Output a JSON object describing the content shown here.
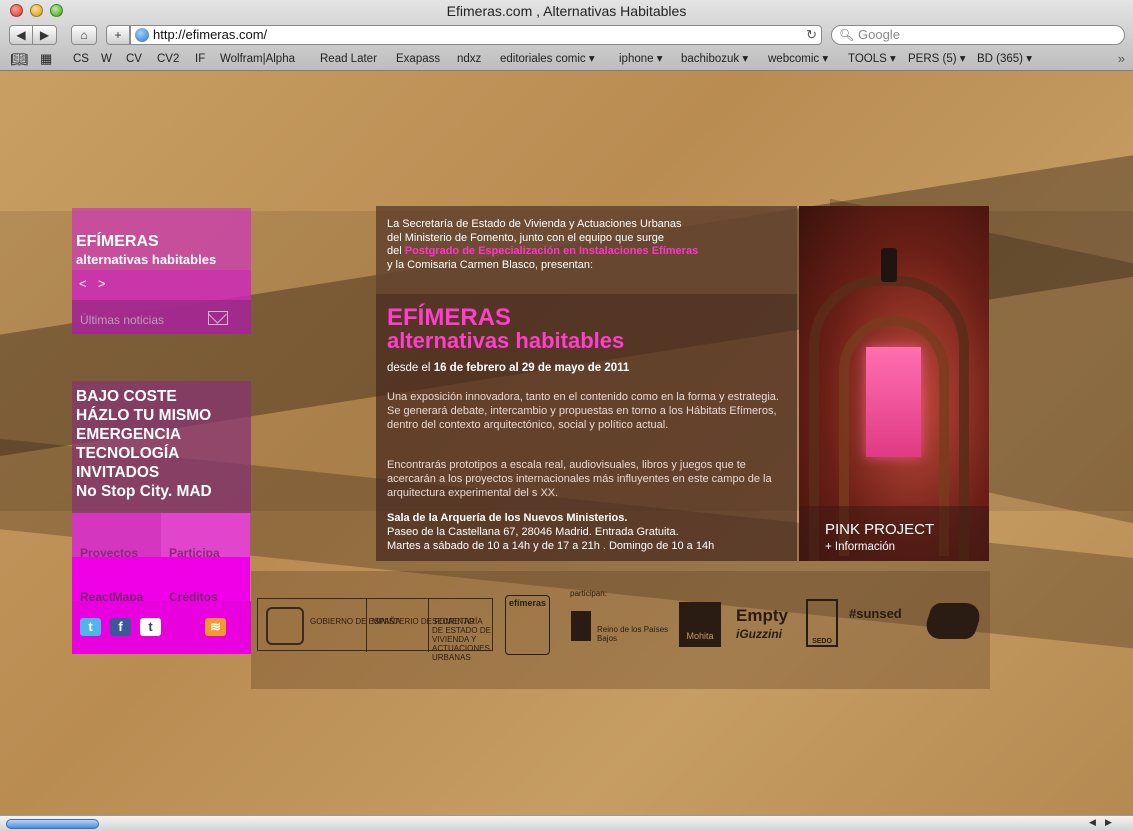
{
  "window": {
    "title": "Efimeras.com , Alternativas Habitables"
  },
  "toolbar": {
    "back": "◀",
    "forward": "▶",
    "home": "⌂",
    "add": "+",
    "url": "http://efimeras.com/",
    "reload": "↻",
    "search_placeholder": "Google",
    "search_icon": "🔍︎"
  },
  "bookmarks": [
    {
      "label": "CS"
    },
    {
      "label": "W"
    },
    {
      "label": "CV"
    },
    {
      "label": "CV2"
    },
    {
      "label": "IF"
    },
    {
      "label": "Wolfram|Alpha"
    },
    {
      "label": "Read Later"
    },
    {
      "label": "Exapass"
    },
    {
      "label": "ndxz"
    },
    {
      "label": "editoriales comic ▾"
    },
    {
      "label": "iphone ▾"
    },
    {
      "label": "bachibozuk ▾"
    },
    {
      "label": "webcomic ▾"
    },
    {
      "label": "TOOLS ▾"
    },
    {
      "label": "PERS (5) ▾"
    },
    {
      "label": "BD (365) ▾"
    }
  ],
  "sidebar": {
    "title": "EFÍMERAS",
    "subtitle": "alternativas habitables",
    "prev": "<",
    "next": ">",
    "news": "Últimas noticias",
    "topics": [
      "BAJO COSTE",
      "HÁZLO TU MISMO",
      "EMERGENCIA",
      "TECNOLOGÍA",
      "INVITADOS",
      "No Stop City. MAD"
    ],
    "menu": {
      "proyectos": "Proyectos",
      "participa": "Participa",
      "reactmapa": "ReactMapa",
      "creditos": "Créditos"
    },
    "social": {
      "twitter": "t",
      "facebook": "f",
      "tumblr": "t",
      "rss": "≋"
    }
  },
  "center": {
    "intro_1": "La Secretaría de Estado de Vivienda y Actuaciones Urbanas",
    "intro_2": "del Ministerio de Fomento, junto con el equipo que surge",
    "intro_3a": "del ",
    "intro_3b": "Postgrado de Especialización en Instalaciones Efímeras",
    "intro_4": "y la Comisaria Carmen Blasco, presentan:",
    "title": "EFÍMERAS",
    "subtitle": "alternativas habitables",
    "dates_a": "desde el ",
    "dates_b": "16 de febrero al 29 de mayo de 2011",
    "desc1": "Una exposición innovadora, tanto en el contenido como en la forma y estrategia. Se generará debate, intercambio y propuestas en torno a los Hábitats Efímeros, dentro del contexto arquitectónico, social y político actual.",
    "desc2": "Encontrarás prototipos a escala real, audiovisuales, libros y juegos que te acercarán a los proyectos internacionales más influyentes en este campo de la arquitectura experimental del s XX.",
    "venue_name": "Sala de la Arquería de los Nuevos Ministerios.",
    "venue_address": "Paseo de la Castellana 67, 28046 Madrid. Entrada Gratuita.",
    "venue_hours": "Martes a sábado de 10 a 14h y de 17 a 21h . Domingo de 10 a 14h"
  },
  "photo": {
    "title": "PINK PROJECT",
    "info": "+ Información"
  },
  "logos": {
    "gobierno": "GOBIERNO DE ESPAÑA",
    "ministerio": "MINISTERIO DE FOMENTO",
    "secretaria": "SECRETARÍA DE ESTADO DE VIVIENDA Y ACTUACIONES URBANAS",
    "efimeras": "efímeras",
    "participan": "participan:",
    "paises": "Reino de los Países Bajos",
    "mohita": "Mohita",
    "empty": "Empty",
    "iguzzini": "iGuzzini",
    "sedo": "SEDO",
    "sunsed": "#sunsed"
  }
}
